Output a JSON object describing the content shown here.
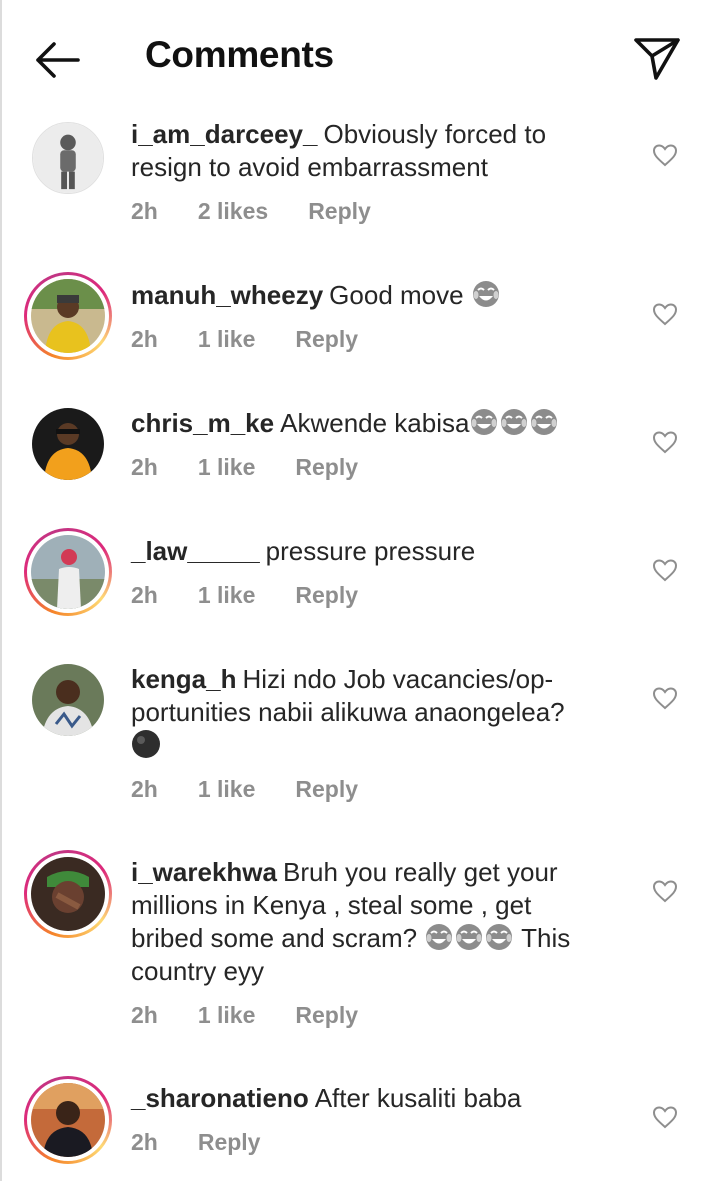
{
  "header": {
    "title": "Comments",
    "back_icon": "arrow-left-icon",
    "send_icon": "direct-send-icon"
  },
  "comments": [
    {
      "username": "i_am_darceey_",
      "text": "Obviously forced to resign to avoid embarrassment",
      "time": "2h",
      "likes": "2 likes",
      "reply": "Reply",
      "story_ring": false,
      "emojis": []
    },
    {
      "username": "manuh_wheezy",
      "text": "Good move",
      "time": "2h",
      "likes": "1 like",
      "reply": "Reply",
      "story_ring": true,
      "emojis": [
        "tears-of-joy"
      ]
    },
    {
      "username": "chris_m_ke",
      "text": "Akwende kabisa",
      "time": "2h",
      "likes": "1 like",
      "reply": "Reply",
      "story_ring": false,
      "emojis": [
        "tears-of-joy",
        "tears-of-joy",
        "tears-of-joy"
      ]
    },
    {
      "username": "_law_____",
      "text": "pressure pressure",
      "time": "2h",
      "likes": "1 like",
      "reply": "Reply",
      "story_ring": true,
      "emojis": []
    },
    {
      "username": "kenga_h",
      "text": "Hizi ndo Job vacancies/op-portunities nabii alikuwa anaongelea?",
      "time": "2h",
      "likes": "1 like",
      "reply": "Reply",
      "story_ring": false,
      "emojis": [
        "dark-face"
      ]
    },
    {
      "username": "i_warekhwa",
      "text": "Bruh you really get your millions in Kenya , steal some , get bribed some and scram?",
      "text_after": "This country eyy",
      "time": "2h",
      "likes": "1 like",
      "reply": "Reply",
      "story_ring": true,
      "emojis": [
        "tears-of-joy",
        "tears-of-joy",
        "tears-of-joy"
      ]
    },
    {
      "username": "_sharonatieno",
      "text": "After kusaliti baba",
      "time": "2h",
      "likes": "",
      "reply": "Reply",
      "story_ring": true,
      "emojis": []
    }
  ],
  "colors": {
    "meta": "#8e8e8e",
    "text": "#262626",
    "ring_start": "#f58529",
    "ring_end": "#dd2a7b"
  }
}
